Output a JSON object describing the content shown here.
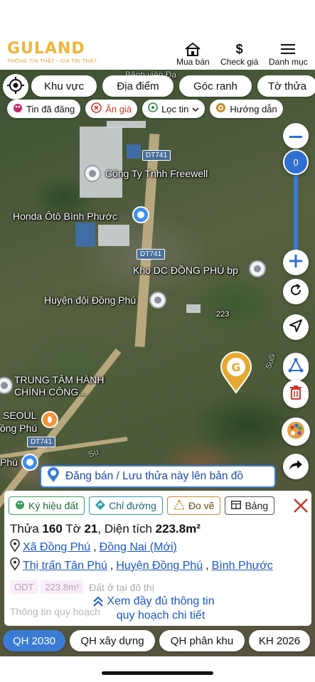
{
  "header": {
    "logo_text": "GULAND",
    "logo_tagline": "THÔNG TIN THẬT - GIÁ TRỊ THẬT",
    "buttons": [
      {
        "label": "Mua bán",
        "icon": "house-icon"
      },
      {
        "label": "Check giá",
        "icon": "dollar-icon"
      },
      {
        "label": "Danh mục",
        "icon": "menu-icon"
      }
    ]
  },
  "toolbar": {
    "pills": [
      "Khu vực",
      "Địa điểm",
      "Góc ranh",
      "Tờ thửa"
    ],
    "chips": [
      {
        "label": "Tin đã đăng",
        "icon": "palette-icon"
      },
      {
        "label": "Ẩn giá",
        "icon": "x-circle-icon"
      },
      {
        "label": "Lọc tin",
        "icon": "location-pin-icon"
      },
      {
        "label": "Hướng dẫn",
        "icon": "target-icon"
      }
    ]
  },
  "map": {
    "labels": {
      "freewell": "Công Ty Tnhh Freewell",
      "honda": "Honda Ôtô Bình Phước",
      "kho_dc": "Kho DC ĐỒNG PHÚ bp",
      "huyen_doi": "Huyện đội Đồng Phú",
      "trung_tam_1": "TRUNG TÂM HÀNH",
      "trung_tam_2": "CHÍNH CÔNG...",
      "seoul": "SEOUL",
      "seoul_sub": "ồng Phú",
      "phu": "Phú",
      "top_partial": "Bệnh viện Đa",
      "marker_num": "223",
      "river": "Suối",
      "road_su": "Su"
    },
    "road_tags": [
      "DT741",
      "DT741",
      "DT741"
    ],
    "zoom_value": "0"
  },
  "publish_button": "Đăng bán / Lưu thửa này lên bản đồ",
  "sheet": {
    "tabs": [
      {
        "label": "Ký hiệu đất",
        "icon": "palette-icon"
      },
      {
        "label": "Chỉ đường",
        "icon": "direction-icon"
      },
      {
        "label": "Đo vẽ",
        "icon": "measure-icon"
      },
      {
        "label": "Bảng",
        "icon": "table-icon"
      }
    ],
    "title_prefix_1": "Thửa ",
    "thua": "160",
    "title_prefix_2": " Tờ ",
    "to": "21",
    "title_prefix_3": ", Diện tích ",
    "area": "223.8m²",
    "loc_new": [
      "Xã Đồng Phú",
      "Đồng Nai (Mới)"
    ],
    "loc_old": [
      "Thị trấn Tân Phú",
      "Huyện Đồng Phú",
      "Bình Phước"
    ],
    "zone": {
      "code": "ODT",
      "area": "223.8m²",
      "desc": "Đất ở tại đô thị"
    },
    "faded_info": "Thông tin quy hoạch",
    "see_more_1": "Xem đầy đủ thông tin",
    "see_more_2": "quy hoạch chi tiết"
  },
  "bottom_tabs": [
    "QH 2030",
    "QH xây dựng",
    "QH phân khu",
    "KH 2026"
  ],
  "colors": {
    "accent_blue": "#3a7bd5",
    "logo_gold": "#f0b43a",
    "link_blue": "#1a56c8"
  }
}
